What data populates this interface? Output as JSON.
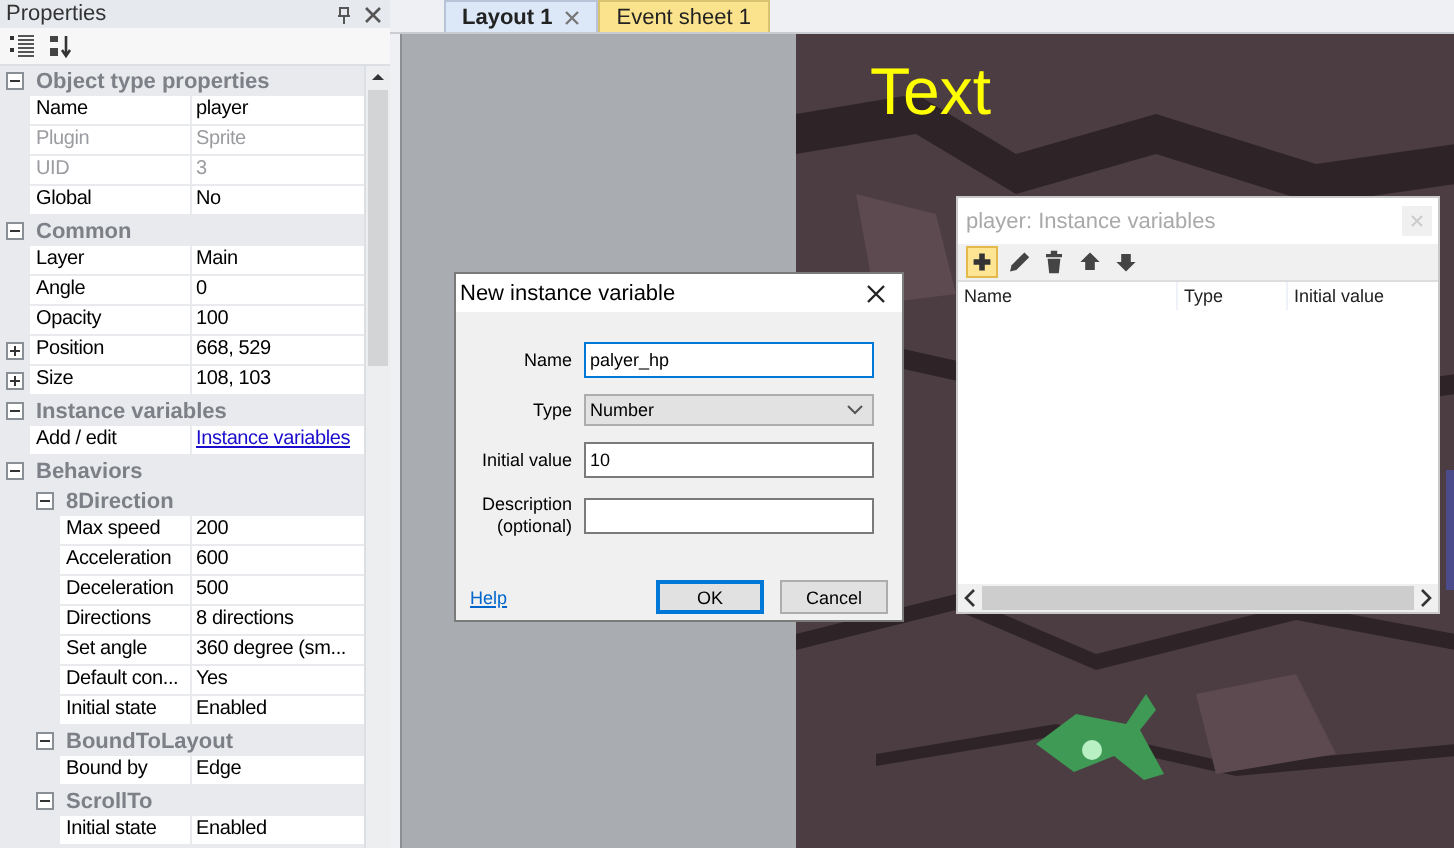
{
  "properties_panel": {
    "title": "Properties",
    "groups": [
      {
        "label": "Object type properties",
        "expanded": true,
        "rows": [
          {
            "name": "Name",
            "value": "player",
            "disabled": false
          },
          {
            "name": "Plugin",
            "value": "Sprite",
            "disabled": true
          },
          {
            "name": "UID",
            "value": "3",
            "disabled": true
          },
          {
            "name": "Global",
            "value": "No",
            "disabled": false
          }
        ]
      },
      {
        "label": "Common",
        "expanded": true,
        "rows": [
          {
            "name": "Layer",
            "value": "Main",
            "disabled": false
          },
          {
            "name": "Angle",
            "value": "0",
            "disabled": false
          },
          {
            "name": "Opacity",
            "value": "100",
            "disabled": false
          },
          {
            "name": "Position",
            "value": "668, 529",
            "disabled": false,
            "expanded": false
          },
          {
            "name": "Size",
            "value": "108, 103",
            "disabled": false,
            "expanded": false
          }
        ]
      },
      {
        "label": "Instance variables",
        "expanded": true,
        "rows": [
          {
            "name": "Add / edit",
            "value": "Instance variables",
            "kind": "link",
            "disabled": false
          }
        ]
      },
      {
        "label": "Behaviors",
        "expanded": true,
        "children": [
          {
            "label": "8Direction",
            "expanded": true,
            "rows": [
              {
                "name": "Max speed",
                "value": "200",
                "disabled": false
              },
              {
                "name": "Acceleration",
                "value": "600",
                "disabled": false
              },
              {
                "name": "Deceleration",
                "value": "500",
                "disabled": false
              },
              {
                "name": "Directions",
                "value": "8 directions",
                "disabled": false
              },
              {
                "name": "Set angle",
                "value": "360 degree (sm...",
                "disabled": false
              },
              {
                "name": "Default con...",
                "value": "Yes",
                "disabled": false
              },
              {
                "name": "Initial state",
                "value": "Enabled",
                "disabled": false
              }
            ]
          },
          {
            "label": "BoundToLayout",
            "expanded": true,
            "rows": [
              {
                "name": "Bound by",
                "value": "Edge",
                "disabled": false
              }
            ]
          },
          {
            "label": "ScrollTo",
            "expanded": true,
            "rows": [
              {
                "name": "Initial state",
                "value": "Enabled",
                "disabled": false
              }
            ]
          }
        ]
      }
    ]
  },
  "tabs": [
    {
      "label": "Layout 1",
      "selected": true
    },
    {
      "label": "Event sheet 1",
      "selected": false
    }
  ],
  "layout": {
    "text_object": "Text"
  },
  "dialog": {
    "title": "New instance variable",
    "fields": [
      {
        "kind": "text",
        "label": "Name",
        "value": "palyer_hp",
        "focused": true
      },
      {
        "kind": "select",
        "label": "Type",
        "value": "Number"
      },
      {
        "kind": "text",
        "label": "Initial value",
        "value": "10",
        "focused": false
      },
      {
        "kind": "text",
        "label": "Description (optional)",
        "focused": false
      }
    ],
    "help": "Help",
    "buttons": [
      {
        "label": "OK",
        "default": true
      },
      {
        "label": "Cancel",
        "default": false
      }
    ]
  },
  "variables_panel": {
    "title": "player: Instance variables",
    "tools": [
      {
        "kind": "add",
        "selected": true
      },
      {
        "kind": "edit",
        "selected": false
      },
      {
        "kind": "delete",
        "selected": false
      },
      {
        "kind": "up",
        "selected": false
      },
      {
        "kind": "down",
        "selected": false
      }
    ],
    "columns": [
      "Name",
      "Type",
      "Initial value"
    ]
  }
}
